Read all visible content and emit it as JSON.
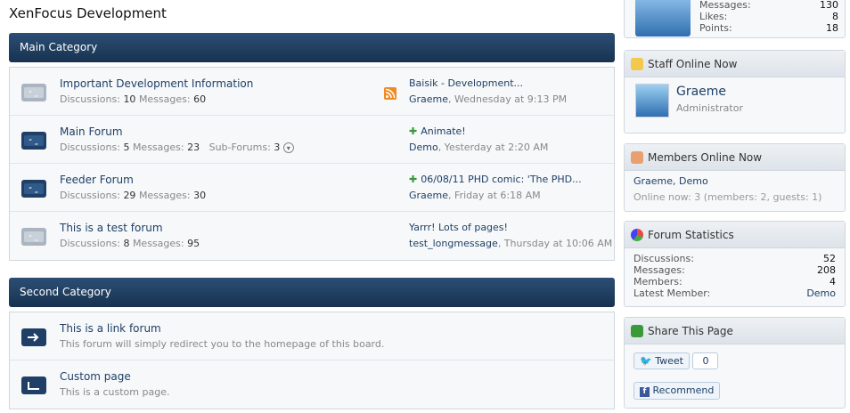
{
  "page_title": "XenFocus Development",
  "categories": [
    {
      "title": "Main Category",
      "nodes": [
        {
          "title": "Important Development Information",
          "stats": [
            {
              "label": "Discussions:",
              "value": "10"
            },
            {
              "label": "Messages:",
              "value": "60"
            }
          ],
          "last_title": "Baisik - Development...",
          "last_user": "Graeme",
          "last_date": ", Wednesday at 9:13 PM",
          "has_rss": true,
          "icon_style": "read"
        },
        {
          "title": "Main Forum",
          "stats": [
            {
              "label": "Discussions:",
              "value": "5"
            },
            {
              "label": "Messages:",
              "value": "23"
            }
          ],
          "subforums_label": "Sub-Forums:",
          "subforums_value": "3",
          "last_title": "Animate!",
          "last_user": "Demo",
          "last_date": ", Yesterday at 2:20 AM",
          "icon_style": "unread"
        },
        {
          "title": "Feeder Forum",
          "stats": [
            {
              "label": "Discussions:",
              "value": "29"
            },
            {
              "label": "Messages:",
              "value": "30"
            }
          ],
          "last_title": "06/08/11 PHD comic: 'The PHD...",
          "last_user": "Graeme",
          "last_date": ", Friday at 6:18 AM",
          "icon_style": "unread"
        },
        {
          "title": "This is a test forum",
          "stats": [
            {
              "label": "Discussions:",
              "value": "8"
            },
            {
              "label": "Messages:",
              "value": "95"
            }
          ],
          "last_title": "Yarrr! Lots of pages!",
          "last_user": "test_longmessage",
          "last_date": ", Thursday at 10:06 AM",
          "icon_style": "read"
        }
      ]
    },
    {
      "title": "Second Category",
      "nodes": [
        {
          "title": "This is a link forum",
          "description": "This forum will simply redirect you to the homepage of this board."
        },
        {
          "title": "Custom page",
          "description": "This is a custom page."
        }
      ]
    }
  ],
  "sidebar": {
    "top_stats": [
      {
        "label": "Messages:",
        "value": "130"
      },
      {
        "label": "Likes:",
        "value": "8"
      },
      {
        "label": "Points:",
        "value": "18"
      }
    ],
    "staff_online": {
      "heading": "Staff Online Now",
      "name": "Graeme",
      "role": "Administrator"
    },
    "members_online": {
      "heading": "Members Online Now",
      "names_1": "Graeme",
      "sep": ", ",
      "names_2": "Demo",
      "summary": "Online now: 3 (members: 2, guests: 1)"
    },
    "forum_stats": {
      "heading": "Forum Statistics",
      "rows": [
        {
          "label": "Discussions:",
          "value": "52"
        },
        {
          "label": "Messages:",
          "value": "208"
        },
        {
          "label": "Members:",
          "value": "4"
        },
        {
          "label": "Latest Member:",
          "value": "Demo"
        }
      ]
    },
    "share": {
      "heading": "Share This Page",
      "tweet": "Tweet",
      "tweet_count": "0",
      "recommend": "Recommend"
    }
  },
  "colors": {
    "category_header": "#1f3f66",
    "link": "#1f3f66",
    "new_post": "#3a9a3a",
    "rss": "#f08a24"
  }
}
